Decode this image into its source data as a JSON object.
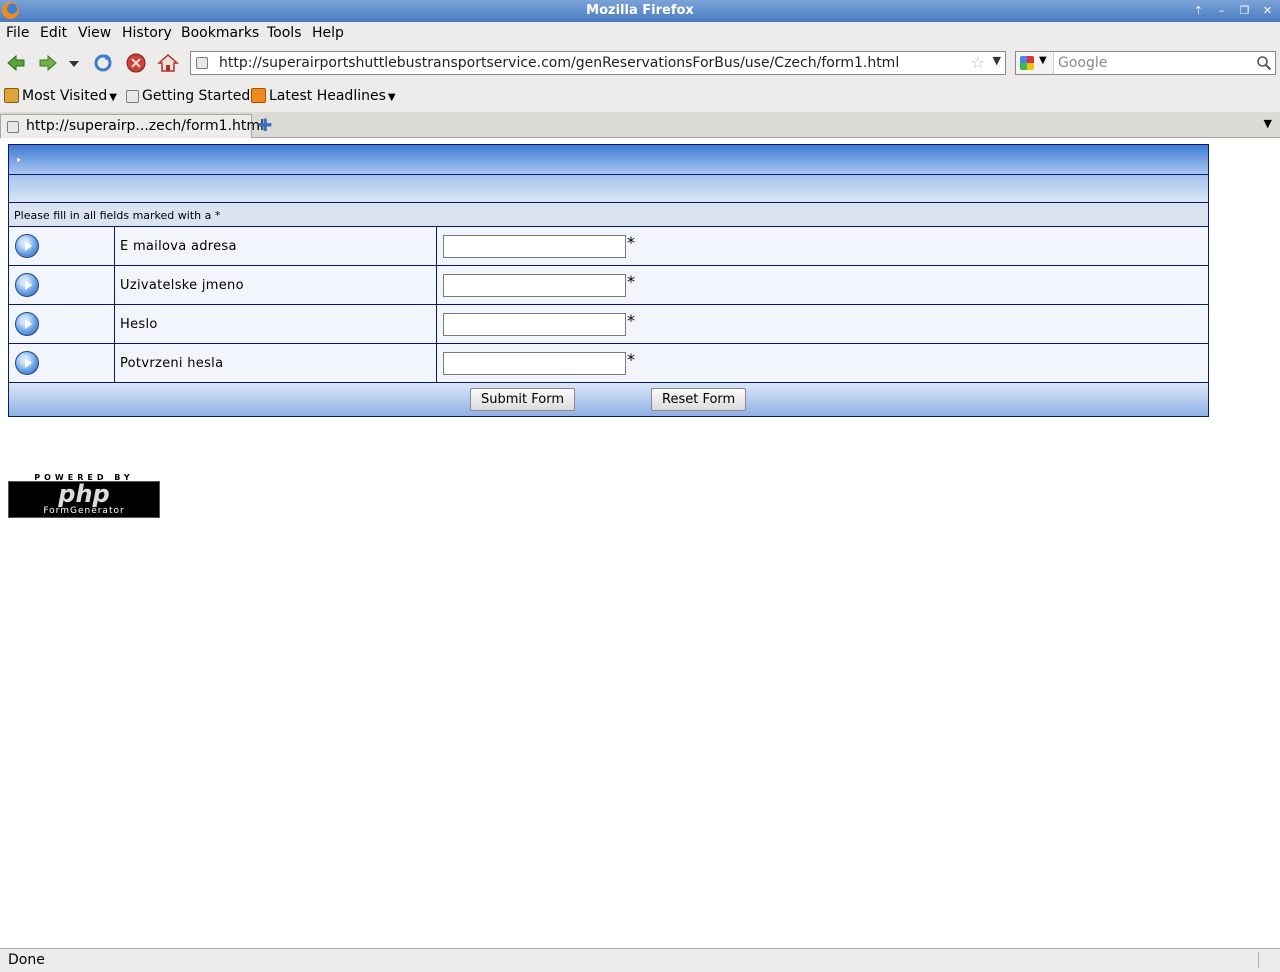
{
  "window": {
    "title": "Mozilla Firefox"
  },
  "menu": [
    "File",
    "Edit",
    "View",
    "History",
    "Bookmarks",
    "Tools",
    "Help"
  ],
  "navbar": {
    "url": "http://superairportshuttlebustransportservice.com/genReservationsForBus/use/Czech/form1.html",
    "search_placeholder": "Google"
  },
  "bookmarks": [
    "Most Visited",
    "Getting Started",
    "Latest Headlines"
  ],
  "tab": {
    "label": "http://superairp...zech/form1.html"
  },
  "form": {
    "note": "Please fill in all fields marked with a *",
    "fields": [
      {
        "label": "E mailova adresa",
        "value": "",
        "required_mark": "*"
      },
      {
        "label": "Uzivatelske jmeno",
        "value": "",
        "required_mark": "*"
      },
      {
        "label": "Heslo",
        "value": "",
        "required_mark": "*"
      },
      {
        "label": "Potvrzeni hesla",
        "value": "",
        "required_mark": "*"
      }
    ],
    "submit_label": "Submit Form",
    "reset_label": "Reset Form"
  },
  "badge": {
    "powered_by": "POWERED BY",
    "logo": "php",
    "product": "FormGenerator"
  },
  "status": {
    "text": "Done"
  },
  "colors": {
    "titlebar": "#4a7cc0",
    "form_header": "#3f7bd6",
    "form_border": "#0a1a6a"
  }
}
